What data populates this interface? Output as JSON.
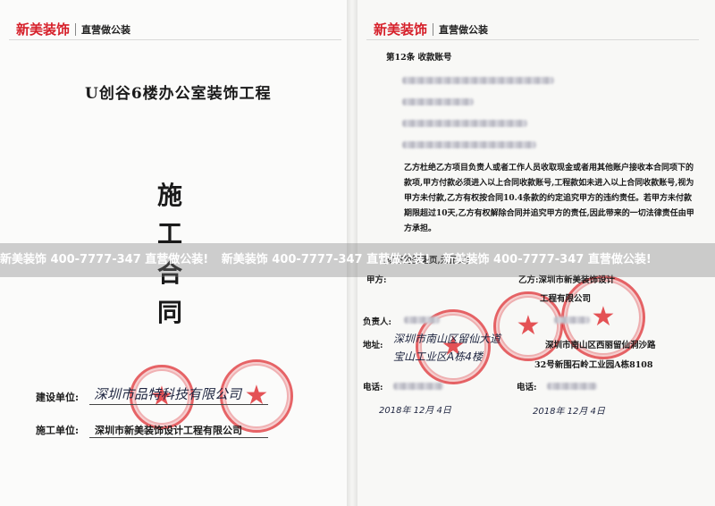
{
  "brand": {
    "name": "新美装饰",
    "tagline": "直营做公装"
  },
  "left": {
    "title": "U创谷6楼办公室装饰工程",
    "contract_chars": [
      "施",
      "工",
      "合",
      "同"
    ],
    "client_label": "建设单位:",
    "client_signature": "深圳市品特科技有限公司",
    "contractor_label": "施工单位:",
    "contractor_value": "深圳市新美装饰设计工程有限公司"
  },
  "right": {
    "clause_title": "第12条  收款账号",
    "body": "乙方杜绝乙方项目负责人或者工作人员收取现金或者用其他账户接收本合同项下的款项,甲方付款必须进入以上合同收款账号,工程款如未进入以上合同收款账号,视为甲方未付款,乙方有权按合同10.4条款的约定追究甲方的违约责任。若甲方未付款期限超过10天,乙方有权解除合同并追究甲方的责任,因此带来的一切法律责任由甲方承担。",
    "below_text": "(以下为签署页,无正文)",
    "party_a": "甲方:",
    "party_b": "乙方:深圳市新美装饰设计",
    "party_b_cont": "工程有限公司",
    "responsible": "负责人:",
    "address_label": "地址:",
    "address_hand_1": "深圳市南山区留仙大道",
    "address_hand_2": "宝山工业区A栋4楼",
    "address_b_1": "深圳市南山区西丽留仙洞沙路",
    "address_b_2": "32号新围石岭工业园A栋8108",
    "phone_a": "电话:",
    "phone_b": "电话:",
    "date_a": "2018年 12月 4日",
    "date_b": "2018年 12月 4日"
  },
  "watermark": {
    "items": [
      "新美装饰 400-7777-347 直营做公装!",
      "新美装饰 400-7777-347 直营做公装!",
      "新美装饰 400-7777-347 直营做公装!"
    ]
  }
}
